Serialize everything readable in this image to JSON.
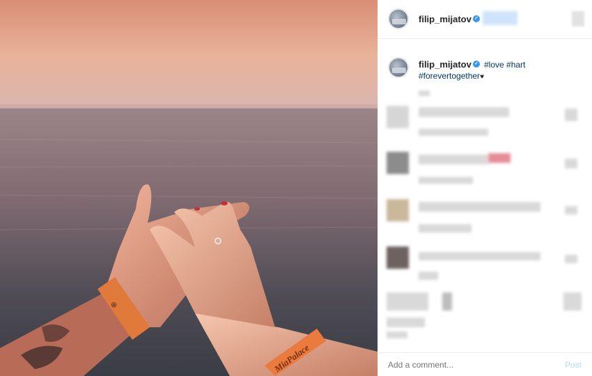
{
  "post": {
    "username": "filip_mijatov",
    "verified_glyph": "✓",
    "caption_hashtags": "#love #hart",
    "caption_hashtags_line2": "#forevertogether",
    "caption_heart": "♥",
    "wristband_text": "MiaPalace"
  },
  "header": {
    "username": "filip_mijatov",
    "icons": [
      "verified-icon",
      "more-options-icon"
    ]
  },
  "comment_box": {
    "placeholder": "Add a comment...",
    "post_label": "Post"
  },
  "colors": {
    "link": "#003569",
    "verified": "#3897f0",
    "post_disabled": "#b2dffc"
  }
}
